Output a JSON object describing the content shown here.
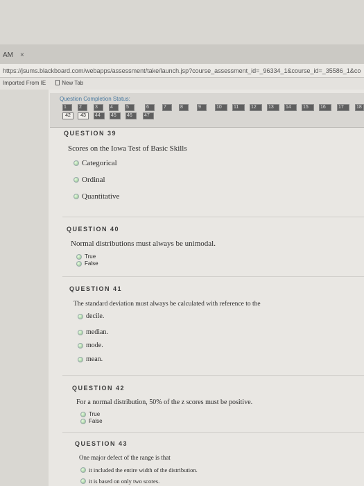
{
  "browser": {
    "tab_title": "AM",
    "tab_close": "×",
    "url": "https://jsums.blackboard.com/webapps/assessment/take/launch.jsp?course_assessment_id=_96334_1&course_id=_35586_1&co",
    "bookmarks": [
      "Imported From IE",
      "New Tab"
    ]
  },
  "status": {
    "title": "Question Completion Status:",
    "row1": [
      "1",
      "2",
      "3",
      "4",
      "5",
      "6",
      "7",
      "8",
      "9",
      "10",
      "11",
      "12",
      "13",
      "14",
      "15",
      "16",
      "17",
      "18"
    ],
    "row2": [
      "42",
      "43",
      "44",
      "45",
      "46",
      "47"
    ]
  },
  "questions": [
    {
      "head": "QUESTION 39",
      "text": "Scores on the Iowa Test of Basic Skills",
      "options": [
        "Categorical",
        "Ordinal",
        "Quantitative"
      ]
    },
    {
      "head": "QUESTION 40",
      "text": "Normal distributions must always be unimodal.",
      "options": [
        "True",
        "False"
      ]
    },
    {
      "head": "QUESTION 41",
      "text": "The standard deviation must always be calculated with reference to the",
      "options": [
        "decile.",
        "median.",
        "mode.",
        "mean."
      ]
    },
    {
      "head": "QUESTION 42",
      "text": "For a normal distribution, 50% of the z scores must be positive.",
      "options": [
        "True",
        "False"
      ]
    },
    {
      "head": "QUESTION 43",
      "text": "One major defect of the range is that",
      "options": [
        "it included the entire width of the distribution.",
        "it is based on only two scores."
      ]
    }
  ]
}
